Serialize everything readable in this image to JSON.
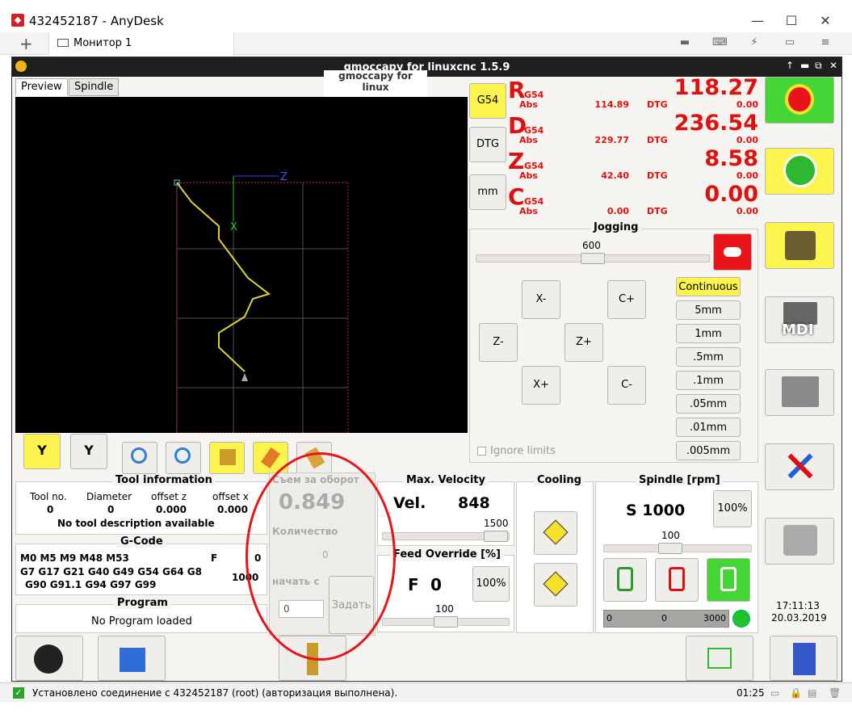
{
  "anydesk": {
    "title": "432452187 - AnyDesk",
    "tab_label": "Монитор 1",
    "status_message": "Установлено соединение с 432452187 (root) (авторизация выполнена).",
    "status_time": "01:25"
  },
  "gmoccapy": {
    "window_title": "gmoccapy for linuxcnc  1.5.9",
    "tooltip": "gmoccapy for linux",
    "tabs": [
      "Preview",
      "Spindle"
    ],
    "dro_buttons": [
      "G54",
      "DTG",
      "mm"
    ],
    "axes": [
      {
        "letter": "R",
        "system": "G54",
        "value": "118.27",
        "abs": "114.89",
        "dtg": "0.00"
      },
      {
        "letter": "D",
        "system": "G54",
        "value": "236.54",
        "abs": "229.77",
        "dtg": "0.00"
      },
      {
        "letter": "Z",
        "system": "G54",
        "value": "8.58",
        "abs": "42.40",
        "dtg": "0.00"
      },
      {
        "letter": "C",
        "system": "G54",
        "value": "0.00",
        "abs": "0.00",
        "dtg": "0.00"
      }
    ],
    "abs_label": "Abs",
    "dtg_label": "DTG",
    "jogging": {
      "title": "Jogging",
      "speed": "600",
      "buttons": {
        "x_minus": "X-",
        "c_plus": "C+",
        "z_minus": "Z-",
        "z_plus": "Z+",
        "x_plus": "X+",
        "c_minus": "C-"
      },
      "increments": [
        "Continuous",
        "5mm",
        "1mm",
        ".5mm",
        ".1mm",
        ".05mm",
        ".01mm",
        ".005mm"
      ],
      "ignore_limits": "Ignore limits"
    },
    "preview": {
      "z_label": "Z",
      "x_label": "X",
      "y_btn_1": "Y",
      "y_btn_2": "Y"
    },
    "tool_info": {
      "title": "Tool information",
      "headers": [
        "Tool no.",
        "Diameter",
        "offset z",
        "offset x"
      ],
      "values": [
        "0",
        "0",
        "0.000",
        "0.000"
      ],
      "description": "No tool description available"
    },
    "gcode": {
      "title": "G-Code",
      "line1": "M0 M5 M9 M48 M53",
      "f_label": "F",
      "f_value": "0",
      "line2": "G7 G17 G21 G40 G49 G54 G64 G8",
      "s_value": "1000",
      "line3": "G90 G91.1 G94 G97 G99"
    },
    "program": {
      "title": "Program",
      "status": "No Program loaded"
    },
    "custom": {
      "feed_per_rev_label": "Съем за оборот",
      "feed_per_rev_value": "0.849",
      "quantity_label": "Количество",
      "quantity_value": "0",
      "start_label": "начать с",
      "start_value": "0",
      "set_button": "Задать"
    },
    "max_velocity": {
      "title": "Max. Velocity",
      "vel_label": "Vel.",
      "vel_value": "848",
      "slider_max": "1500"
    },
    "feed_override": {
      "title": "Feed Override [%]",
      "f_label": "F",
      "f_value": "0",
      "percent": "100%",
      "slider_value": "100"
    },
    "cooling": {
      "title": "Cooling"
    },
    "spindle": {
      "title": "Spindle [rpm]",
      "speed_label": "S 1000",
      "percent": "100%",
      "slider_value": "100",
      "bar_min": "0",
      "bar_value": "0",
      "bar_max": "3000"
    },
    "clock": {
      "time": "17:11:13",
      "date": "20.03.2019"
    },
    "right_buttons": {
      "mdi": "MDI"
    }
  }
}
